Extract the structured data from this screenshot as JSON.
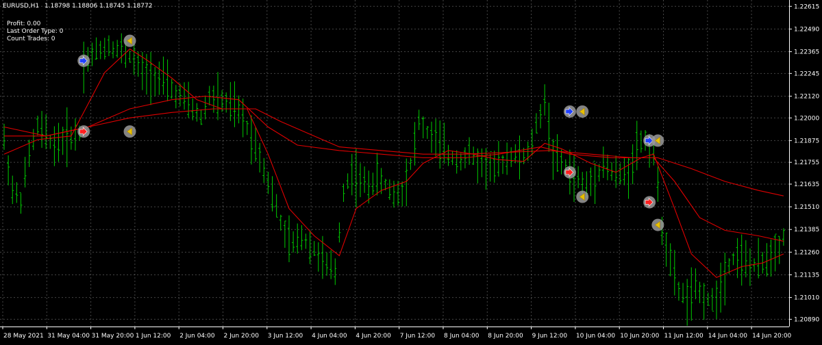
{
  "header": {
    "symbol": "EURUSD,H1",
    "ohlc": "1.18798 1.18806 1.18745 1.18772"
  },
  "info": [
    {
      "label": "Profit: 0.00"
    },
    {
      "label": "Last Order Type: 0"
    },
    {
      "label": "Count Trades: 0"
    }
  ],
  "chart_data": {
    "type": "line",
    "series": [
      {
        "color": "#00cc00",
        "style": "bars"
      },
      {
        "color": "#e00000",
        "style": "line"
      },
      {
        "color": "#e00000",
        "style": "line"
      },
      {
        "color": "#e00000",
        "style": "line"
      }
    ],
    "price_ticks": [
      "1.22615",
      "1.22490",
      "1.22365",
      "1.22245",
      "1.22120",
      "1.22000",
      "1.21875",
      "1.21755",
      "1.21635",
      "1.21510",
      "1.21385",
      "1.21260",
      "1.21135",
      "1.21010",
      "1.20890"
    ],
    "ylim": [
      1.2085,
      1.2265
    ],
    "time_ticks": [
      "28 May 2021",
      "31 May 04:00",
      "31 May 20:00",
      "1 Jun 12:00",
      "2 Jun 04:00",
      "2 Jun 20:00",
      "3 Jun 12:00",
      "4 Jun 04:00",
      "4 Jun 20:00",
      "7 Jun 12:00",
      "8 Jun 04:00",
      "8 Jun 20:00",
      "9 Jun 12:00",
      "10 Jun 04:00",
      "10 Jun 20:00",
      "11 Jun 12:00",
      "14 Jun 04:00",
      "14 Jun 20:00"
    ],
    "price_path": [
      [
        0,
        1.2188
      ],
      [
        2,
        1.216
      ],
      [
        4,
        1.2155
      ],
      [
        6,
        1.218
      ],
      [
        8,
        1.2195
      ],
      [
        10,
        1.219
      ],
      [
        12,
        1.2185
      ],
      [
        14,
        1.2188
      ],
      [
        16,
        1.219
      ],
      [
        18,
        1.2192
      ],
      [
        19,
        1.223
      ],
      [
        21,
        1.2235
      ],
      [
        23,
        1.2238
      ],
      [
        25,
        1.224
      ],
      [
        27,
        1.2238
      ],
      [
        29,
        1.2236
      ],
      [
        31,
        1.2232
      ],
      [
        33,
        1.2225
      ],
      [
        35,
        1.2224
      ],
      [
        37,
        1.2222
      ],
      [
        39,
        1.2218
      ],
      [
        41,
        1.2213
      ],
      [
        43,
        1.221
      ],
      [
        45,
        1.2205
      ],
      [
        47,
        1.22
      ],
      [
        49,
        1.2212
      ],
      [
        51,
        1.221
      ],
      [
        53,
        1.2208
      ],
      [
        55,
        1.2206
      ],
      [
        57,
        1.22
      ],
      [
        59,
        1.219
      ],
      [
        61,
        1.218
      ],
      [
        63,
        1.2165
      ],
      [
        65,
        1.215
      ],
      [
        67,
        1.2135
      ],
      [
        69,
        1.213
      ],
      [
        71,
        1.2135
      ],
      [
        73,
        1.213
      ],
      [
        75,
        1.2125
      ],
      [
        77,
        1.2118
      ],
      [
        79,
        1.2115
      ],
      [
        81,
        1.216
      ],
      [
        83,
        1.217
      ],
      [
        85,
        1.2165
      ],
      [
        87,
        1.2163
      ],
      [
        89,
        1.2167
      ],
      [
        91,
        1.2163
      ],
      [
        93,
        1.2158
      ],
      [
        95,
        1.216
      ],
      [
        97,
        1.2175
      ],
      [
        99,
        1.2198
      ],
      [
        101,
        1.2192
      ],
      [
        103,
        1.2188
      ],
      [
        105,
        1.2182
      ],
      [
        107,
        1.2178
      ],
      [
        109,
        1.2177
      ],
      [
        111,
        1.218
      ],
      [
        113,
        1.2176
      ],
      [
        115,
        1.2174
      ],
      [
        117,
        1.2172
      ],
      [
        119,
        1.2176
      ],
      [
        121,
        1.218
      ],
      [
        123,
        1.2178
      ],
      [
        125,
        1.218
      ],
      [
        127,
        1.2195
      ],
      [
        129,
        1.221
      ],
      [
        131,
        1.218
      ],
      [
        133,
        1.2175
      ],
      [
        135,
        1.217
      ],
      [
        137,
        1.2166
      ],
      [
        139,
        1.2162
      ],
      [
        141,
        1.2168
      ],
      [
        143,
        1.2175
      ],
      [
        145,
        1.217
      ],
      [
        147,
        1.2168
      ],
      [
        149,
        1.217
      ],
      [
        151,
        1.2185
      ],
      [
        153,
        1.2188
      ],
      [
        155,
        1.218
      ],
      [
        157,
        1.214
      ],
      [
        159,
        1.212
      ],
      [
        161,
        1.2105
      ],
      [
        163,
        1.21
      ],
      [
        165,
        1.2105
      ],
      [
        167,
        1.2102
      ],
      [
        169,
        1.2098
      ],
      [
        171,
        1.2108
      ],
      [
        173,
        1.212
      ],
      [
        175,
        1.2125
      ],
      [
        177,
        1.212
      ],
      [
        179,
        1.2118
      ],
      [
        181,
        1.212
      ],
      [
        183,
        1.2125
      ],
      [
        185,
        1.213
      ],
      [
        186,
        1.2135
      ]
    ],
    "ma_fast": [
      [
        0,
        1.218
      ],
      [
        8,
        1.2188
      ],
      [
        16,
        1.219
      ],
      [
        24,
        1.2225
      ],
      [
        30,
        1.2238
      ],
      [
        34,
        1.2232
      ],
      [
        40,
        1.2222
      ],
      [
        46,
        1.221
      ],
      [
        52,
        1.2205
      ],
      [
        58,
        1.2205
      ],
      [
        63,
        1.218
      ],
      [
        68,
        1.215
      ],
      [
        74,
        1.2135
      ],
      [
        80,
        1.2124
      ],
      [
        84,
        1.215
      ],
      [
        90,
        1.216
      ],
      [
        96,
        1.2165
      ],
      [
        100,
        1.2175
      ],
      [
        106,
        1.2182
      ],
      [
        112,
        1.218
      ],
      [
        118,
        1.2177
      ],
      [
        124,
        1.2176
      ],
      [
        129,
        1.2186
      ],
      [
        133,
        1.2183
      ],
      [
        140,
        1.2175
      ],
      [
        146,
        1.217
      ],
      [
        152,
        1.2178
      ],
      [
        155,
        1.218
      ],
      [
        160,
        1.215
      ],
      [
        164,
        1.2125
      ],
      [
        170,
        1.2112
      ],
      [
        176,
        1.2118
      ],
      [
        181,
        1.212
      ],
      [
        186,
        1.2125
      ]
    ],
    "ma_mid": [
      [
        0,
        1.2195
      ],
      [
        10,
        1.219
      ],
      [
        20,
        1.2195
      ],
      [
        30,
        1.2205
      ],
      [
        40,
        1.221
      ],
      [
        48,
        1.2212
      ],
      [
        56,
        1.221
      ],
      [
        63,
        1.2195
      ],
      [
        70,
        1.2185
      ],
      [
        80,
        1.2182
      ],
      [
        90,
        1.218
      ],
      [
        100,
        1.2178
      ],
      [
        110,
        1.2178
      ],
      [
        118,
        1.218
      ],
      [
        128,
        1.2184
      ],
      [
        135,
        1.218
      ],
      [
        145,
        1.2178
      ],
      [
        155,
        1.2178
      ],
      [
        160,
        1.2165
      ],
      [
        166,
        1.2145
      ],
      [
        172,
        1.2138
      ],
      [
        180,
        1.2135
      ],
      [
        186,
        1.2132
      ]
    ],
    "ma_slow": [
      [
        0,
        1.219
      ],
      [
        10,
        1.219
      ],
      [
        20,
        1.2195
      ],
      [
        30,
        1.22
      ],
      [
        40,
        1.2203
      ],
      [
        50,
        1.2205
      ],
      [
        60,
        1.2205
      ],
      [
        66,
        1.2198
      ],
      [
        74,
        1.219
      ],
      [
        80,
        1.2184
      ],
      [
        90,
        1.2182
      ],
      [
        100,
        1.218
      ],
      [
        110,
        1.218
      ],
      [
        120,
        1.2181
      ],
      [
        130,
        1.2182
      ],
      [
        140,
        1.218
      ],
      [
        150,
        1.2178
      ],
      [
        156,
        1.2178
      ],
      [
        164,
        1.2172
      ],
      [
        172,
        1.2165
      ],
      [
        180,
        1.216
      ],
      [
        186,
        1.2157
      ]
    ],
    "markers": [
      {
        "bar": 19,
        "price": 1.22315,
        "dir": "buy"
      },
      {
        "bar": 19,
        "price": 1.21925,
        "dir": "sell"
      },
      {
        "bar": 30,
        "price": 1.22425,
        "dir": "close"
      },
      {
        "bar": 30,
        "price": 1.21925,
        "dir": "close"
      },
      {
        "bar": 135,
        "price": 1.22035,
        "dir": "buy"
      },
      {
        "bar": 138,
        "price": 1.22035,
        "dir": "close"
      },
      {
        "bar": 135,
        "price": 1.217,
        "dir": "sell"
      },
      {
        "bar": 138,
        "price": 1.21565,
        "dir": "close"
      },
      {
        "bar": 154,
        "price": 1.21875,
        "dir": "buy"
      },
      {
        "bar": 156,
        "price": 1.21875,
        "dir": "close"
      },
      {
        "bar": 154,
        "price": 1.21535,
        "dir": "sell"
      },
      {
        "bar": 156,
        "price": 1.2141,
        "dir": "close"
      }
    ]
  }
}
